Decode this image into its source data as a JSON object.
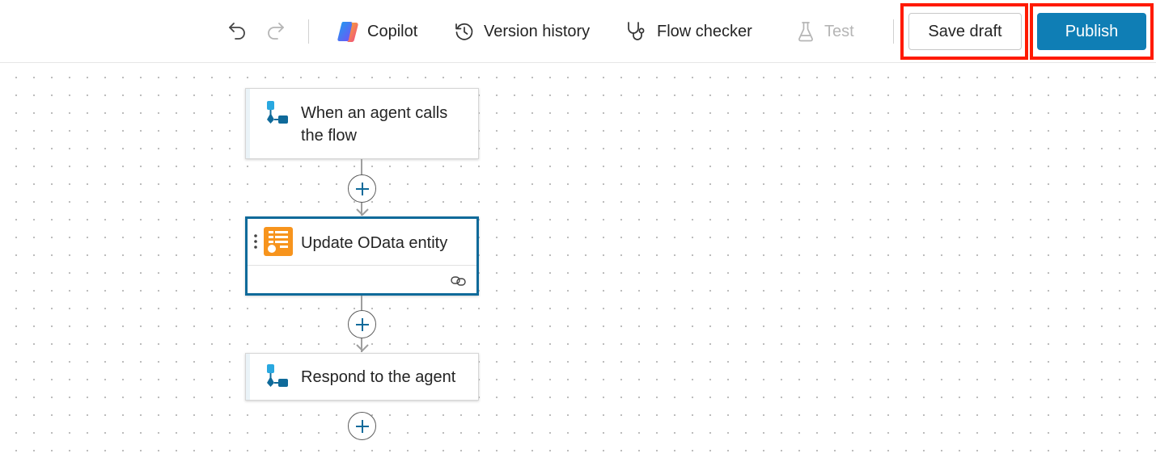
{
  "toolbar": {
    "copilot_label": "Copilot",
    "version_history_label": "Version history",
    "flow_checker_label": "Flow checker",
    "test_label": "Test",
    "save_draft_label": "Save draft",
    "publish_label": "Publish",
    "undo_icon": "undo-icon",
    "redo_icon": "redo-icon"
  },
  "flow": {
    "steps": [
      {
        "title": "When an agent calls the flow",
        "icon": "agent-trigger-icon"
      },
      {
        "title": "Update OData entity",
        "icon": "odata-icon",
        "selected": true
      },
      {
        "title": "Respond to the agent",
        "icon": "agent-respond-icon"
      }
    ]
  },
  "colors": {
    "publish_bg": "#0f7eb5",
    "highlight": "#ff1a00",
    "selected_border": "#0f6a9a",
    "odata_orange": "#f7941d"
  }
}
